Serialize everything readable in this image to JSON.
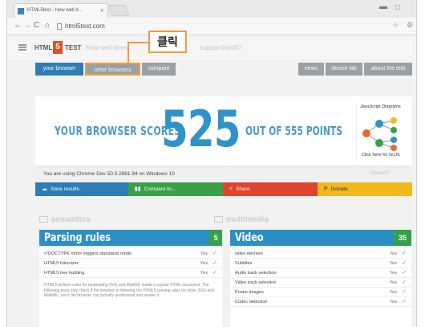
{
  "browser": {
    "tab_title": "HTML5test - How well d...",
    "tab_close": "x",
    "url": "html5test.com",
    "minimize": "▬",
    "maximize": "□"
  },
  "site": {
    "logo_html": "HTML",
    "logo_5": "5",
    "logo_test": "TEST",
    "nav_q1": "How well does",
    "nav_q2": "support html5?"
  },
  "callout": {
    "label": "클릭",
    "color": "#f29b38"
  },
  "nav": {
    "your_browser": "your browser",
    "other_browsers": "other browsers",
    "compare": "compare",
    "news": "news",
    "device_lab": "device lab",
    "about": "about the test"
  },
  "score": {
    "prefix": "YOUR BROWSER SCORES",
    "number": "525",
    "suffix": "OUT OF 555 POINTS",
    "promo_title": "JavaScript Diagrams",
    "promo_cta": "Click here for GoJS"
  },
  "ua": {
    "text": "You are using Chrome Dev 50.0.2661.94 on Windows 10",
    "right": "Correct?"
  },
  "actions": {
    "save": "Save results",
    "compare": "Compare to...",
    "share": "Share",
    "donate": "Donate"
  },
  "sections": {
    "semantics": "semantics",
    "multimedia": "multimedia"
  },
  "parsing": {
    "title": "Parsing rules",
    "score": "5",
    "rows": [
      {
        "label": "<!DOCTYPE html> triggers standards mode",
        "value": "Yes"
      },
      {
        "label": "HTML5 tokenizer",
        "value": "Yes"
      },
      {
        "label": "HTML5 tree building",
        "value": "Yes"
      }
    ],
    "description": "HTML5 defines rules for embedding SVG and MathML inside a regular HTML document. The following tests only check if the browser is following the HTML5 parsing rules for inline SVG and MathML, not if the browser can actually understand and render it."
  },
  "video": {
    "title": "Video",
    "score": "35",
    "rows": [
      {
        "label": "video element",
        "value": "Yes"
      },
      {
        "label": "Subtitles",
        "value": "Yes"
      },
      {
        "label": "Audio track selection",
        "value": "Yes"
      },
      {
        "label": "Video track selection",
        "value": "Yes"
      },
      {
        "label": "Poster images",
        "value": "Yes"
      },
      {
        "label": "Codec detection",
        "value": "Yes"
      }
    ]
  }
}
